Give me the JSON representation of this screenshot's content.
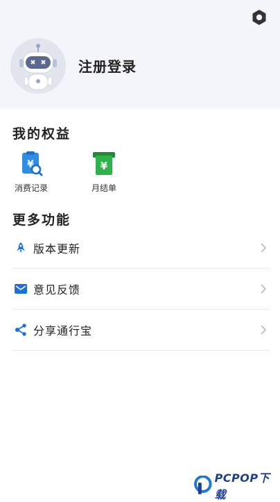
{
  "header": {
    "login_label": "注册登录",
    "settings_icon": "hexagon-settings-icon",
    "avatar_icon": "robot-avatar"
  },
  "perks": {
    "title": "我的权益",
    "items": [
      {
        "label": "消费记录",
        "icon": "receipt-search-icon",
        "color": "#2f8de4"
      },
      {
        "label": "月结单",
        "icon": "yuan-bill-icon",
        "color": "#2fb24a"
      }
    ]
  },
  "more": {
    "title": "更多功能",
    "items": [
      {
        "label": "版本更新",
        "icon": "rocket-icon",
        "color": "#1f6fdc"
      },
      {
        "label": "意见反馈",
        "icon": "mail-icon",
        "color": "#1f6fdc"
      },
      {
        "label": "分享通行宝",
        "icon": "share-icon",
        "color": "#1f6fdc"
      }
    ]
  },
  "watermark": {
    "text": "PCPOP下载",
    "icon": "pcpop-logo-icon"
  }
}
